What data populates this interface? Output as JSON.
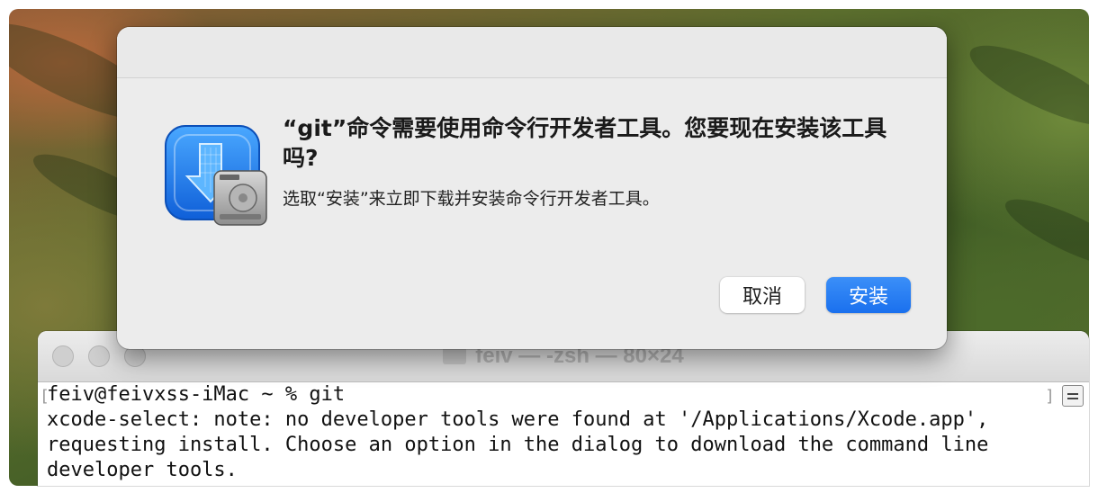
{
  "terminal": {
    "window_title": "feiv — -zsh — 80×24",
    "lines": [
      "feiv@feivxss-iMac ~ % git",
      "xcode-select: note: no developer tools were found at '/Applications/Xcode.app',",
      "requesting install. Choose an option in the dialog to download the command line",
      "developer tools."
    ]
  },
  "dialog": {
    "title": "“git”命令需要使用命令行开发者工具。您要现在安装该工具吗?",
    "message": "选取“安装”来立即下载并安装命令行开发者工具。",
    "cancel_label": "取消",
    "install_label": "安装",
    "icon": "xcode-cli-installer-icon"
  },
  "colors": {
    "accent": "#1a70ee",
    "dialog_bg": "#ececec"
  }
}
